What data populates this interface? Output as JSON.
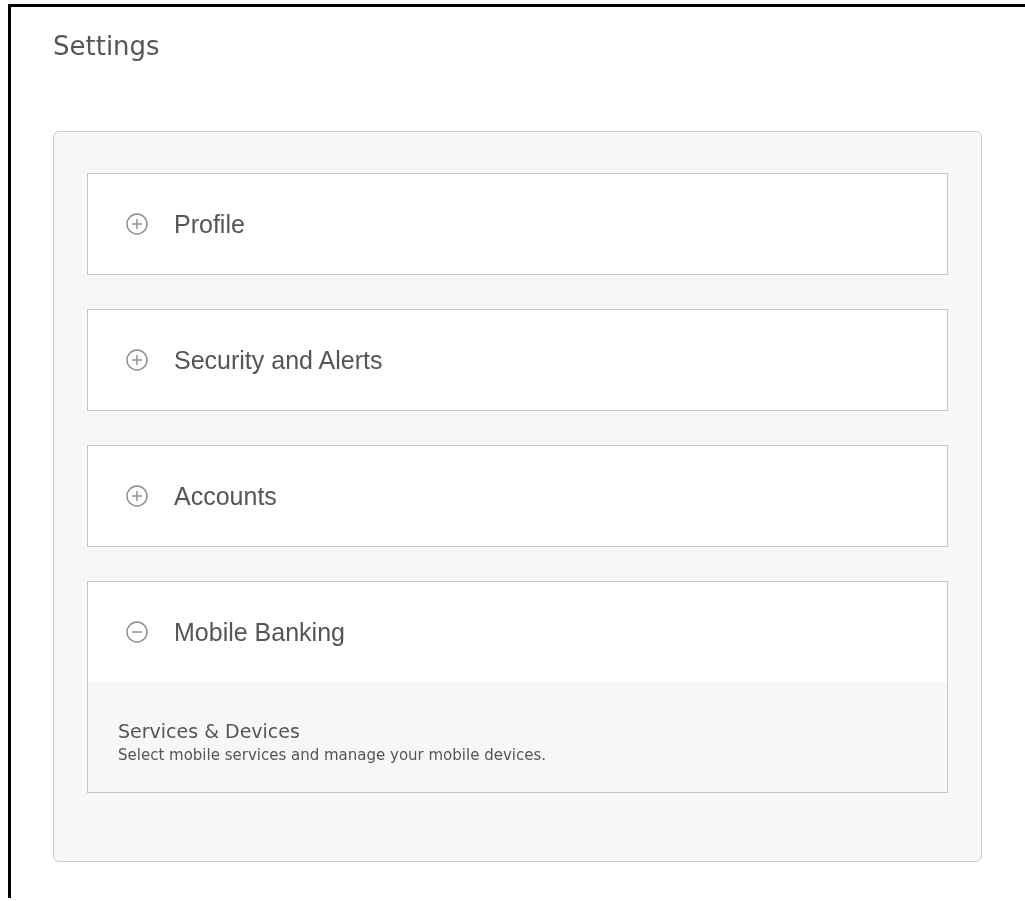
{
  "title": "Settings",
  "sections": [
    {
      "label": "Profile",
      "expanded": false
    },
    {
      "label": "Security and Alerts",
      "expanded": false
    },
    {
      "label": "Accounts",
      "expanded": false
    },
    {
      "label": "Mobile Banking",
      "expanded": true,
      "items": [
        {
          "title": "Services & Devices",
          "description": "Select mobile services and manage your mobile devices."
        }
      ]
    }
  ]
}
